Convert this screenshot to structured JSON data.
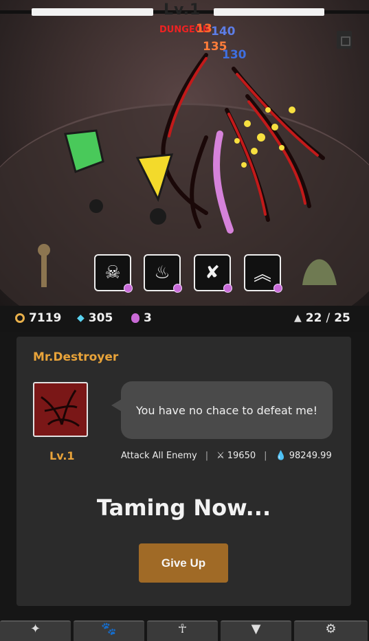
{
  "header": {
    "stage_level": "Lv.1",
    "dungeon_label": "DUNGEON",
    "damage_numbers": [
      "13",
      "140",
      "135",
      "130"
    ]
  },
  "skills": [
    {
      "name": "fire-skull-skill",
      "icon": "fire-skull-icon"
    },
    {
      "name": "flame-drop-skill",
      "icon": "flame-drop-icon"
    },
    {
      "name": "slash-skill",
      "icon": "slash-icon"
    },
    {
      "name": "double-arrow-up-skill",
      "icon": "double-chevron-up-icon"
    }
  ],
  "resources": {
    "gold": "7119",
    "gems": "305",
    "potions": "3",
    "population": "22",
    "population_max": "25",
    "population_sep": "/"
  },
  "boss": {
    "name": "Mr.Destroyer",
    "level": "Lv.1",
    "dialog": "You have no chace to defeat me!",
    "skill": "Attack All Enemy",
    "attack": "19650",
    "health": "98249.99",
    "sep": "|"
  },
  "status": {
    "taming": "Taming Now...",
    "give_up": "Give Up"
  },
  "nav": [
    {
      "name": "nav-tab-monsters",
      "icon": "sparkle-icon"
    },
    {
      "name": "nav-tab-pets",
      "icon": "paw-icon"
    },
    {
      "name": "nav-tab-totem",
      "icon": "ankh-icon"
    },
    {
      "name": "nav-tab-shop",
      "icon": "cup-icon"
    },
    {
      "name": "nav-tab-settings",
      "icon": "gear-icon"
    }
  ],
  "colors": {
    "accent": "#e8a33a",
    "button": "#a06a26",
    "panel": "#2b2b2b",
    "bubble": "#4a4a4a"
  }
}
